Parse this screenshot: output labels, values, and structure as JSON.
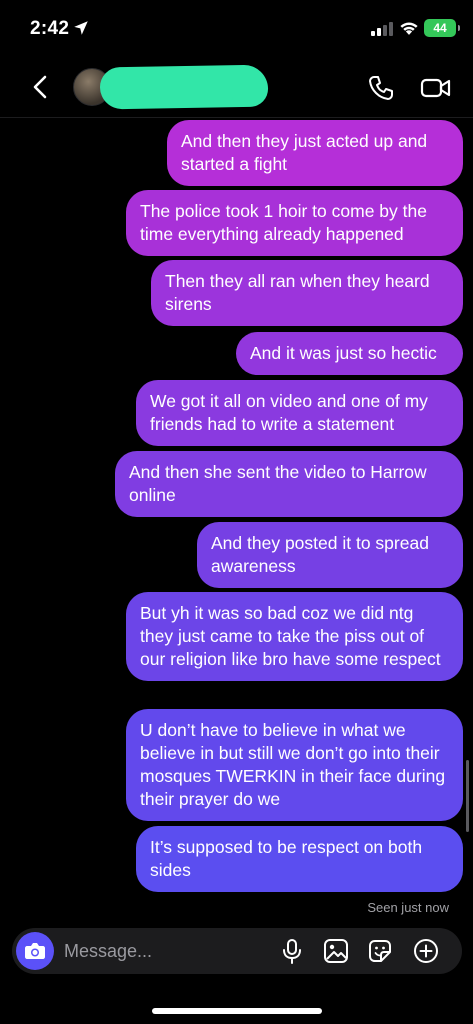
{
  "status_bar": {
    "time": "2:42",
    "battery": "44"
  },
  "header": {
    "contact_name": ""
  },
  "messages": [
    {
      "text": "And then they just acted up and started a fight",
      "color": "#b52fd8"
    },
    {
      "text": "The police took 1 hoir to come by the time everything already happened",
      "color": "#a831d8"
    },
    {
      "text": "Then they all ran when they heard sirens",
      "color": "#9c34dc"
    },
    {
      "text": "And it was just so hectic",
      "color": "#9237dd"
    },
    {
      "text": "We got it all on video and one of my friends had to write a statement",
      "color": "#8a3ae0"
    },
    {
      "text": "And then she sent the video to Harrow online",
      "color": "#803de2"
    },
    {
      "text": "And they posted it to spread awareness",
      "color": "#7640e4"
    },
    {
      "text": "But yh it was so bad coz we did ntg they just came to take the piss out of our religion like bro have some respect",
      "color": "#6c45e8"
    },
    {
      "text": "U don’t have to believe in what we believe in but still we don’t go into their mosques TWERKIN in their face during their prayer do we",
      "color": "#6249ec"
    },
    {
      "text": "It’s supposed to be respect on both sides",
      "color": "#5b4ef0"
    }
  ],
  "seen_label": "Seen just now",
  "composer": {
    "placeholder": "Message..."
  },
  "icons": [
    "location-arrow-icon",
    "signal-icon",
    "wifi-icon",
    "back-chevron-icon",
    "phone-icon",
    "video-call-icon",
    "camera-icon",
    "microphone-icon",
    "gallery-icon",
    "sticker-icon",
    "plus-circle-icon"
  ]
}
